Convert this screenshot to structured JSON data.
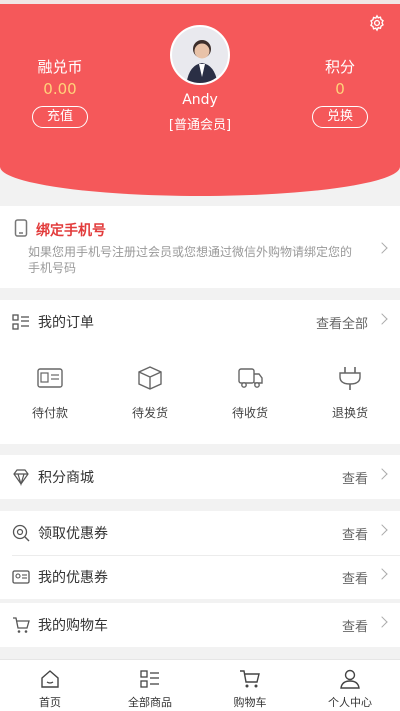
{
  "header": {
    "left_label": "融兑币",
    "left_value": "0.00",
    "left_button": "充值",
    "right_label": "积分",
    "right_value": "0",
    "right_button": "兑换",
    "user_name": "Andy",
    "member_level": "[普通会员]"
  },
  "bind_phone": {
    "title": "绑定手机号",
    "description": "如果您用手机号注册过会员或您想通过微信外购物请绑定您的手机号码"
  },
  "orders": {
    "title": "我的订单",
    "more": "查看全部",
    "items": [
      {
        "label": "待付款",
        "icon": "wallet-icon"
      },
      {
        "label": "待发货",
        "icon": "box-icon"
      },
      {
        "label": "待收货",
        "icon": "truck-icon"
      },
      {
        "label": "退换货",
        "icon": "plug-return-icon"
      }
    ]
  },
  "points_mall": {
    "title": "积分商城",
    "more": "查看"
  },
  "coupons_get": {
    "title": "领取优惠券",
    "more": "查看"
  },
  "my_coupons": {
    "title": "我的优惠券",
    "more": "查看"
  },
  "my_cart": {
    "title": "我的购物车",
    "more": "查看"
  },
  "tabbar": {
    "items": [
      {
        "label": "首页",
        "icon": "home-icon"
      },
      {
        "label": "全部商品",
        "icon": "list-icon"
      },
      {
        "label": "购物车",
        "icon": "cart-icon"
      },
      {
        "label": "个人中心",
        "icon": "user-icon"
      }
    ]
  },
  "colors": {
    "accent": "#f5585a",
    "value_yellow": "#ffd27a",
    "bind_red": "#e23b3b"
  }
}
